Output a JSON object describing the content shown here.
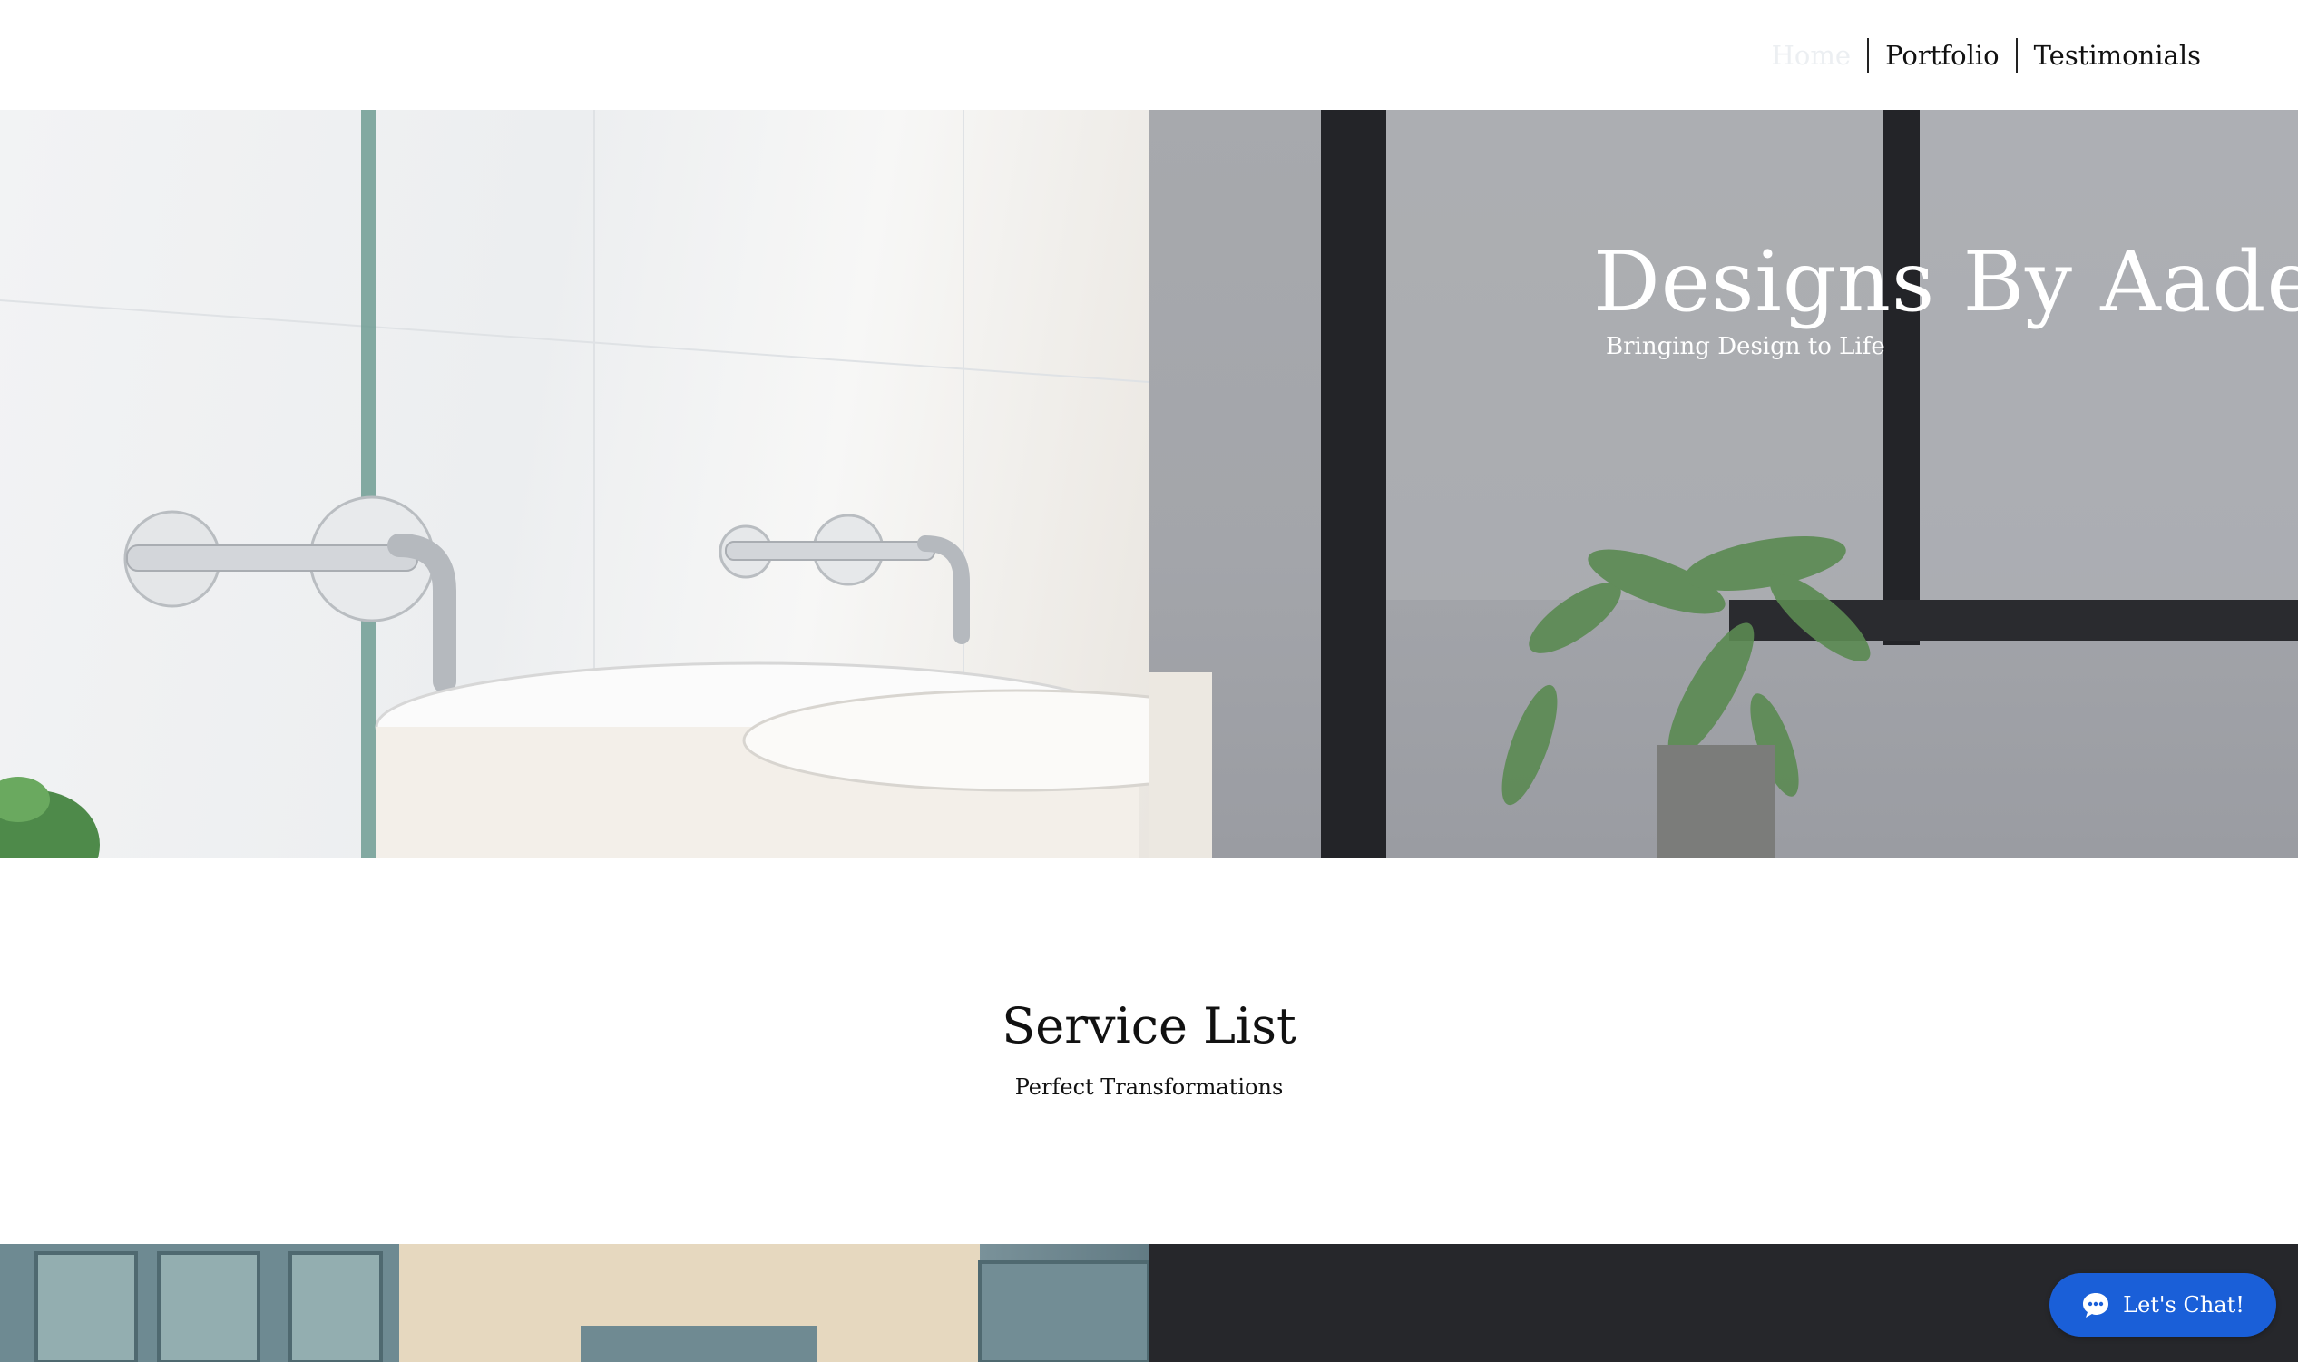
{
  "nav": {
    "items": [
      {
        "label": "Home",
        "active": true
      },
      {
        "label": "Portfolio",
        "active": false
      },
      {
        "label": "Testimonials",
        "active": false
      }
    ]
  },
  "hero": {
    "title": "Designs By Aadee",
    "subtitle": "Bringing Design to Life"
  },
  "services": {
    "title": "Service List",
    "subtitle": "Perfect Transformations"
  },
  "chat": {
    "label": "Let's Chat!",
    "icon": "chat-bubble-icon",
    "color": "#1a5fd8"
  },
  "colors": {
    "bottom_panel": "#26272b",
    "hero_overlay": "#a7a9ad"
  }
}
